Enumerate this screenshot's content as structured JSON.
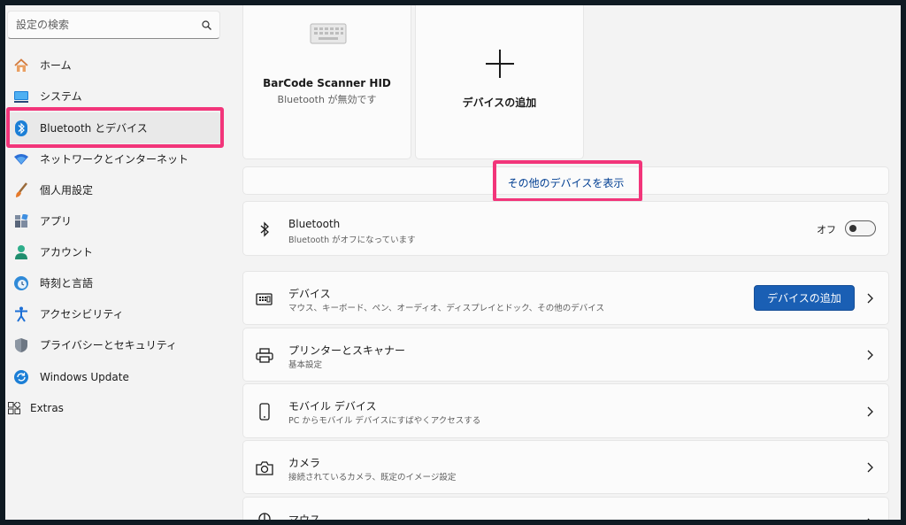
{
  "search": {
    "placeholder": "設定の検索"
  },
  "sidebar": {
    "items": [
      {
        "label": "ホーム",
        "icon": "home-icon"
      },
      {
        "label": "システム",
        "icon": "monitor-icon"
      },
      {
        "label": "Bluetooth とデバイス",
        "icon": "bluetooth-icon",
        "active": true
      },
      {
        "label": "ネットワークとインターネット",
        "icon": "wifi-icon"
      },
      {
        "label": "個人用設定",
        "icon": "brush-icon"
      },
      {
        "label": "アプリ",
        "icon": "apps-icon"
      },
      {
        "label": "アカウント",
        "icon": "person-icon"
      },
      {
        "label": "時刻と言語",
        "icon": "globe-clock-icon"
      },
      {
        "label": "アクセシビリティ",
        "icon": "accessibility-icon"
      },
      {
        "label": "プライバシーとセキュリティ",
        "icon": "shield-icon"
      },
      {
        "label": "Windows Update",
        "icon": "update-icon"
      },
      {
        "label": "Extras",
        "icon": "extras-icon"
      }
    ]
  },
  "device_tiles": [
    {
      "title": "BarCode Scanner HID",
      "subtitle": "Bluetooth が無効です",
      "icon": "keyboard-icon"
    },
    {
      "title": "デバイスの追加",
      "icon": "plus-icon"
    }
  ],
  "show_more_link": "その他のデバイスを表示",
  "bluetooth_row": {
    "title": "Bluetooth",
    "subtitle": "Bluetooth がオフになっています",
    "toggle_label": "オフ",
    "toggle_on": false
  },
  "rows": [
    {
      "title": "デバイス",
      "subtitle": "マウス、キーボード、ペン、オーディオ、ディスプレイとドック、その他のデバイス",
      "button": "デバイスの追加",
      "icon": "devices-icon"
    },
    {
      "title": "プリンターとスキャナー",
      "subtitle": "基本設定",
      "icon": "printer-icon"
    },
    {
      "title": "モバイル デバイス",
      "subtitle": "PC からモバイル デバイスにすばやくアクセスする",
      "icon": "phone-icon"
    },
    {
      "title": "カメラ",
      "subtitle": "接続されているカメラ、既定のイメージ設定",
      "icon": "camera-icon"
    },
    {
      "title": "マウス",
      "icon": "mouse-icon"
    }
  ],
  "colors": {
    "accent": "#1a5fb4",
    "highlight": "#f2357a",
    "link": "#003e92"
  }
}
